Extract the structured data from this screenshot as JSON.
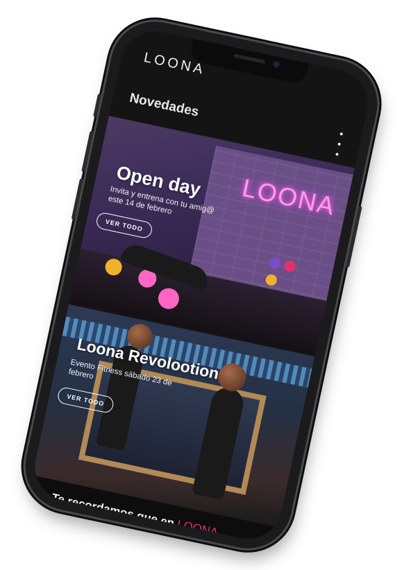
{
  "app": {
    "brand": "LOONA"
  },
  "nav": {
    "title": "Novedades",
    "menu_icon": "more-vertical-icon"
  },
  "cards": [
    {
      "title": "Open day",
      "subtitle": "Invita y entrena con tu amig@ este 14 de febrero",
      "button": "VER TODO",
      "neon_sign": "LOONA"
    },
    {
      "title": "Loona Revolootion",
      "subtitle": "Evento Fitness sábado 23 de febrero",
      "button": "VER TODO"
    }
  ],
  "reminder": {
    "prefix": "Te recordamos que en",
    "brand": "LOONA"
  },
  "colors": {
    "accent": "#e0306e",
    "screen_bg": "#141414",
    "phone_frame": "#1b1b1d"
  }
}
